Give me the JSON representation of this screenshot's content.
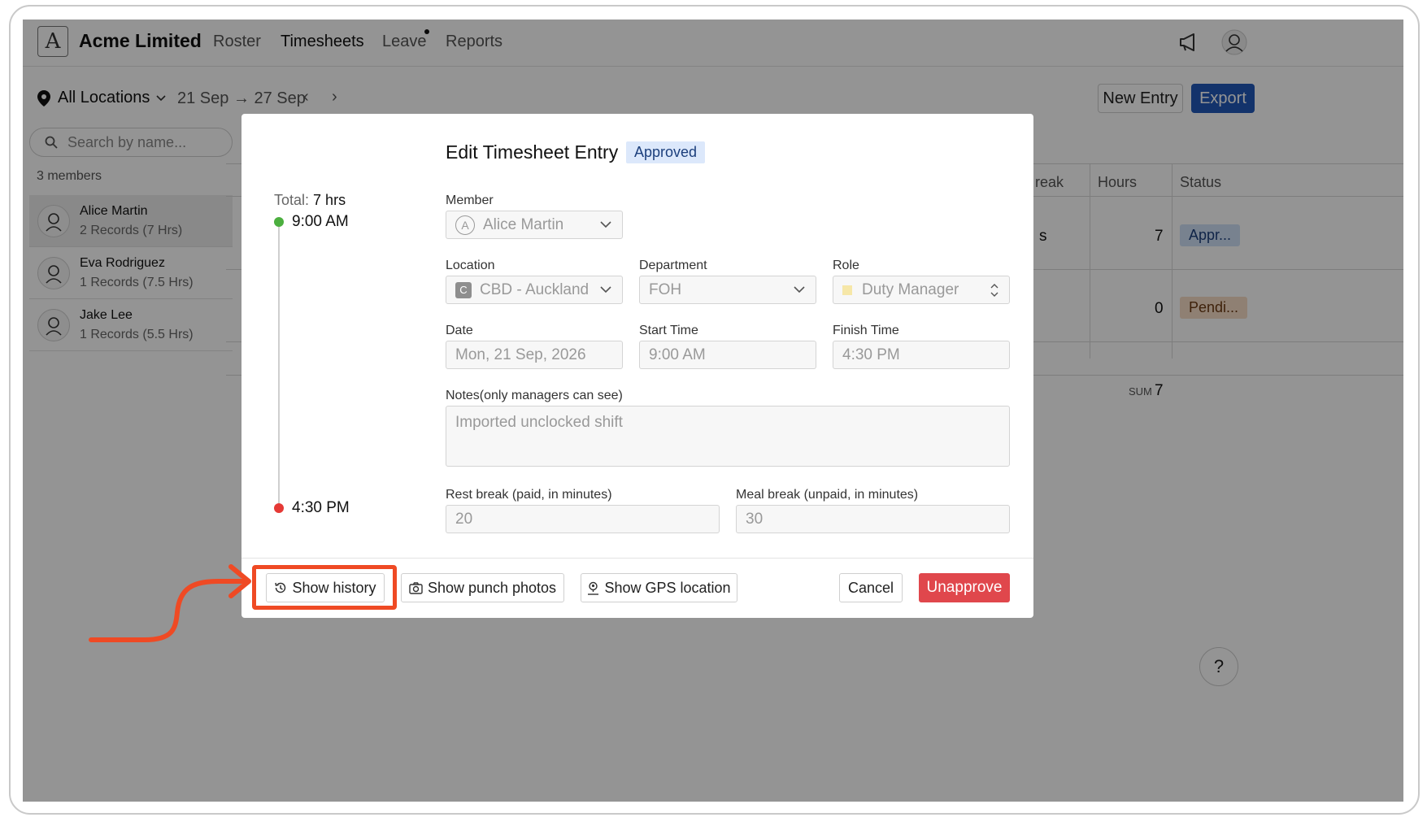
{
  "app": {
    "brand": "Acme Limited",
    "logo_letter": "A",
    "nav": [
      {
        "label": "Roster"
      },
      {
        "label": "Timesheets"
      },
      {
        "label": "Leave"
      },
      {
        "label": "Reports"
      }
    ],
    "active_nav": "Timesheets"
  },
  "toolbar": {
    "location": "All Locations",
    "date_range": "21 Sep → 27 Sep",
    "prev_label": "‹",
    "next_label": "›",
    "new_entry_label": "New Entry",
    "export_label": "Export"
  },
  "sidebar": {
    "search_placeholder": "Search by name...",
    "members_count": "3 members",
    "members": [
      {
        "name": "Alice Martin",
        "sub": "2 Records (7 Hrs)"
      },
      {
        "name": "Eva Rodriguez",
        "sub": "1 Records (7.5 Hrs)"
      },
      {
        "name": "Jake Lee",
        "sub": "1 Records (5.5 Hrs)"
      }
    ]
  },
  "table": {
    "headers": {
      "break": "reak",
      "hours": "Hours",
      "status": "Status"
    },
    "rows": [
      {
        "break": "s",
        "hours": "7",
        "status": "Appr..."
      },
      {
        "break": "",
        "hours": "0",
        "status": "Pendi..."
      }
    ],
    "sum_label": "SUM",
    "sum_value": "7"
  },
  "modal": {
    "title": "Edit Timesheet Entry",
    "status_badge": "Approved",
    "total_label": "Total:",
    "total_value": "7 hrs",
    "start_time": "9:00 AM",
    "end_time": "4:30 PM",
    "member_label": "Member",
    "member_value": "Alice Martin",
    "member_initial": "A",
    "location_label": "Location",
    "location_value": "CBD - Auckland",
    "location_initial": "C",
    "department_label": "Department",
    "department_value": "FOH",
    "role_label": "Role",
    "role_value": "Duty Manager",
    "date_label": "Date",
    "date_value": "Mon, 21 Sep, 2026",
    "start_label": "Start Time",
    "start_value": "9:00 AM",
    "finish_label": "Finish Time",
    "finish_value": "4:30 PM",
    "notes_label": "Notes(only managers can see)",
    "notes_value": "Imported unclocked shift",
    "rest_label": "Rest break (paid, in minutes)",
    "rest_value": "20",
    "meal_label": "Meal break (unpaid, in minutes)",
    "meal_value": "30",
    "show_history": "Show history",
    "show_photos": "Show punch photos",
    "show_gps": "Show GPS location",
    "cancel": "Cancel",
    "unapprove": "Unapprove"
  },
  "help_label": "?",
  "colors": {
    "primary": "#2159b8",
    "danger": "#e0474c",
    "approved_bg": "#dce8fb",
    "highlight": "#ef4a24",
    "start_dot": "#4caf3f",
    "end_dot": "#e53935"
  }
}
